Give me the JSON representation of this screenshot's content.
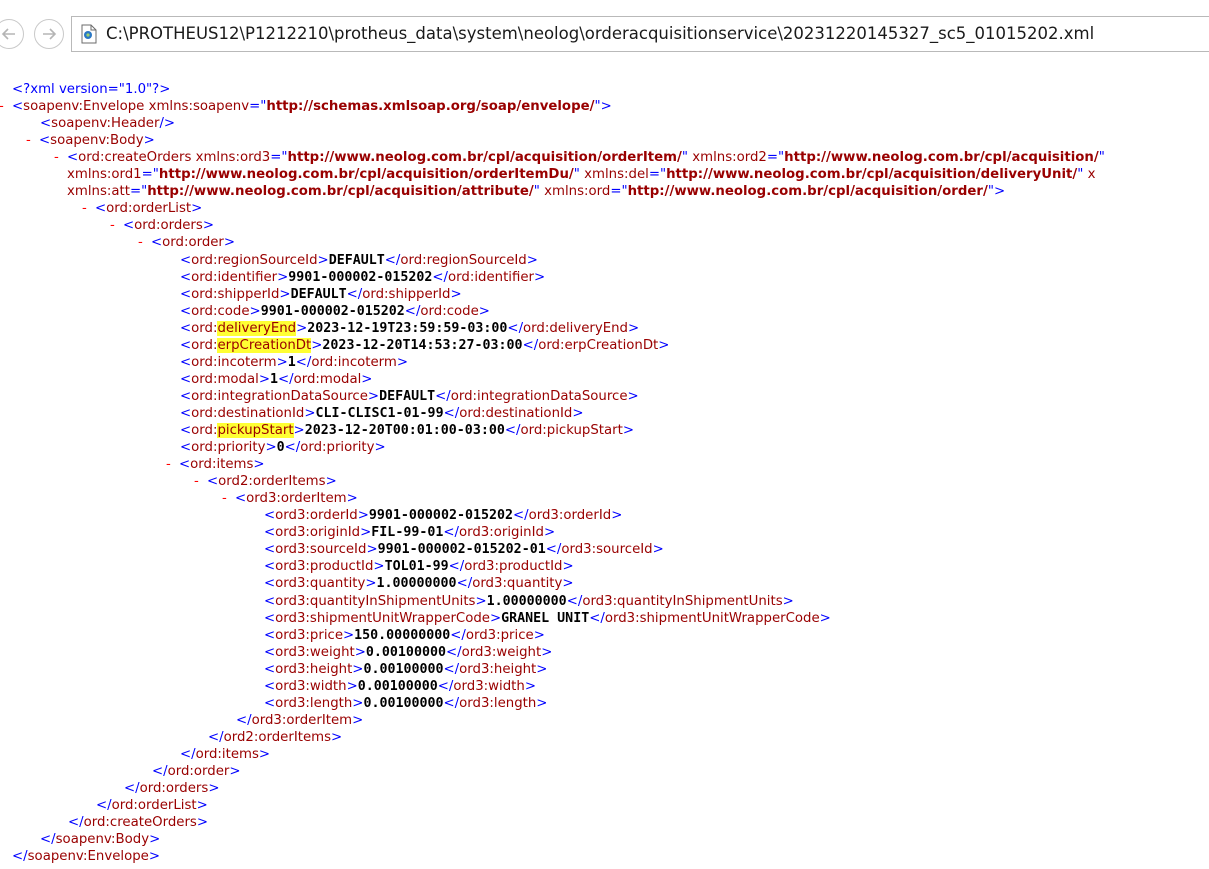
{
  "toolbar": {
    "address": "C:\\PROTHEUS12\\P1212210\\protheus_data\\system\\neolog\\orderacquisitionservice\\20231220145327_sc5_01015202.xml"
  },
  "xml": {
    "declaration": "<?xml version=\"1.0\"?>",
    "envelope_tag": "soapenv:Envelope",
    "envelope_ns_name": "xmlns:soapenv",
    "envelope_ns_value": "http://schemas.xmlsoap.org/soap/envelope/",
    "header_tag": "soapenv:Header",
    "body_tag": "soapenv:Body",
    "create_orders_tag": "ord:createOrders",
    "ns_ord3_name": "xmlns:ord3",
    "ns_ord3_value": "http://www.neolog.com.br/cpl/acquisition/orderItem/",
    "ns_ord2_name": "xmlns:ord2",
    "ns_ord2_value": "http://www.neolog.com.br/cpl/acquisition/",
    "ns_ord1_name": "xmlns:ord1",
    "ns_ord1_value": "http://www.neolog.com.br/cpl/acquisition/orderItemDu/",
    "ns_del_name": "xmlns:del",
    "ns_del_value": "http://www.neolog.com.br/cpl/acquisition/deliveryUnit/",
    "ns_trail": "x",
    "ns_att_name": "xmlns:att",
    "ns_att_value": "http://www.neolog.com.br/cpl/acquisition/attribute/",
    "ns_ord_name": "xmlns:ord",
    "ns_ord_value": "http://www.neolog.com.br/cpl/acquisition/order/",
    "order_list_tag": "ord:orderList",
    "orders_tag": "ord:orders",
    "order_tag": "ord:order",
    "order_fields": [
      {
        "prefix": "ord:",
        "name": "regionSourceId",
        "value": "DEFAULT",
        "highlight": false
      },
      {
        "prefix": "ord:",
        "name": "identifier",
        "value": "9901-000002-015202",
        "highlight": false
      },
      {
        "prefix": "ord:",
        "name": "shipperId",
        "value": "DEFAULT",
        "highlight": false
      },
      {
        "prefix": "ord:",
        "name": "code",
        "value": "9901-000002-015202",
        "highlight": false
      },
      {
        "prefix": "ord:",
        "name": "deliveryEnd",
        "value": "2023-12-19T23:59:59-03:00",
        "highlight": true
      },
      {
        "prefix": "ord:",
        "name": "erpCreationDt",
        "value": "2023-12-20T14:53:27-03:00",
        "highlight": true
      },
      {
        "prefix": "ord:",
        "name": "incoterm",
        "value": "1",
        "highlight": false
      },
      {
        "prefix": "ord:",
        "name": "modal",
        "value": "1",
        "highlight": false
      },
      {
        "prefix": "ord:",
        "name": "integrationDataSource",
        "value": "DEFAULT",
        "highlight": false
      },
      {
        "prefix": "ord:",
        "name": "destinationId",
        "value": "CLI-CLISC1-01-99",
        "highlight": false
      },
      {
        "prefix": "ord:",
        "name": "pickupStart",
        "value": "2023-12-20T00:01:00-03:00",
        "highlight": true
      },
      {
        "prefix": "ord:",
        "name": "priority",
        "value": "0",
        "highlight": false
      }
    ],
    "items_tag": "ord:items",
    "order_items_tag": "ord2:orderItems",
    "order_item_tag": "ord3:orderItem",
    "item_fields": [
      {
        "prefix": "ord3:",
        "name": "orderId",
        "value": "9901-000002-015202",
        "highlight": false
      },
      {
        "prefix": "ord3:",
        "name": "originId",
        "value": "FIL-99-01",
        "highlight": false
      },
      {
        "prefix": "ord3:",
        "name": "sourceId",
        "value": "9901-000002-015202-01",
        "highlight": false
      },
      {
        "prefix": "ord3:",
        "name": "productId",
        "value": "TOL01-99",
        "highlight": false
      },
      {
        "prefix": "ord3:",
        "name": "quantity",
        "value": "1.00000000",
        "highlight": false
      },
      {
        "prefix": "ord3:",
        "name": "quantityInShipmentUnits",
        "value": "1.00000000",
        "highlight": false
      },
      {
        "prefix": "ord3:",
        "name": "shipmentUnitWrapperCode",
        "value": "GRANEL UNIT",
        "highlight": false
      },
      {
        "prefix": "ord3:",
        "name": "price",
        "value": "150.00000000",
        "highlight": false
      },
      {
        "prefix": "ord3:",
        "name": "weight",
        "value": "0.00100000",
        "highlight": false
      },
      {
        "prefix": "ord3:",
        "name": "height",
        "value": "0.00100000",
        "highlight": false
      },
      {
        "prefix": "ord3:",
        "name": "width",
        "value": "0.00100000",
        "highlight": false
      },
      {
        "prefix": "ord3:",
        "name": "length",
        "value": "0.00100000",
        "highlight": false
      }
    ],
    "collapse_marker": "-"
  }
}
